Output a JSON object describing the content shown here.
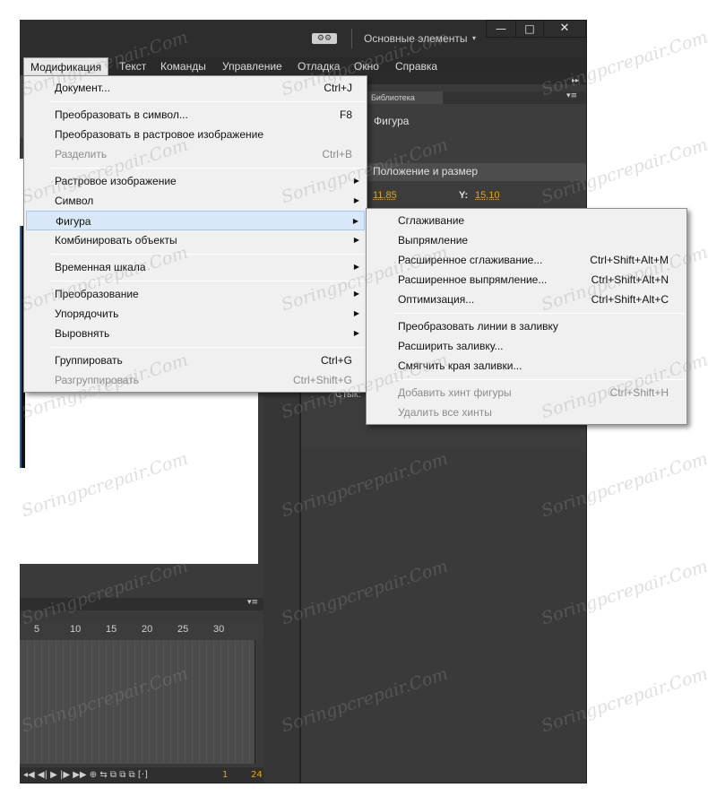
{
  "titlebar": {
    "workspace_label": "Основные элементы",
    "workspace_arrow": "▾",
    "workspace_icon": "⚙⚙",
    "minimize": "—",
    "maximize": "□",
    "close": "✕"
  },
  "menubar": {
    "items": [
      "Модификация",
      "Текст",
      "Команды",
      "Управление",
      "Отладка",
      "Окно",
      "Справка"
    ]
  },
  "panels": {
    "library_tab": "Библиотека",
    "shape_type": "Фигура",
    "position_header": "Положение и размер",
    "x_value": "11,85",
    "y_label": "Y:",
    "y_value": "15,10",
    "stroke_label": "Стык:",
    "expand_icon": "▸▸",
    "panel_menu_icon": "▾≡"
  },
  "timeline": {
    "ticks": [
      "5",
      "10",
      "15",
      "20",
      "25",
      "30"
    ],
    "frame": "1",
    "fps": "24",
    "controls": "◂◀ ◀| ▶ |▶ ▶▶  ⊕ ⇆  ⧉ ⧉ ⧉ [·]"
  },
  "main_menu": {
    "items": [
      {
        "label": "Документ...",
        "shortcut": "Ctrl+J"
      },
      {
        "label": "Преобразовать в символ...",
        "shortcut": "F8"
      },
      {
        "label": "Преобразовать в растровое изображение",
        "shortcut": ""
      },
      {
        "label": "Разделить",
        "shortcut": "Ctrl+B"
      },
      {
        "label": "Растровое изображение",
        "shortcut": ""
      },
      {
        "label": "Символ",
        "shortcut": ""
      },
      {
        "label": "Фигура",
        "shortcut": ""
      },
      {
        "label": "Комбинировать объекты",
        "shortcut": ""
      },
      {
        "label": "Временная шкала",
        "shortcut": ""
      },
      {
        "label": "Преобразование",
        "shortcut": ""
      },
      {
        "label": "Упорядочить",
        "shortcut": ""
      },
      {
        "label": "Выровнять",
        "shortcut": ""
      },
      {
        "label": "Группировать",
        "shortcut": "Ctrl+G"
      },
      {
        "label": "Разгруппировать",
        "shortcut": "Ctrl+Shift+G"
      }
    ],
    "arrow": "▶"
  },
  "sub_menu": {
    "items": [
      {
        "label": "Сглаживание",
        "shortcut": ""
      },
      {
        "label": "Выпрямление",
        "shortcut": ""
      },
      {
        "label": "Расширенное сглаживание...",
        "shortcut": "Ctrl+Shift+Alt+M"
      },
      {
        "label": "Расширенное выпрямление...",
        "shortcut": "Ctrl+Shift+Alt+N"
      },
      {
        "label": "Оптимизация...",
        "shortcut": "Ctrl+Shift+Alt+C"
      },
      {
        "label": "Преобразовать линии в заливку",
        "shortcut": ""
      },
      {
        "label": "Расширить заливку...",
        "shortcut": ""
      },
      {
        "label": "Смягчить края заливки...",
        "shortcut": ""
      },
      {
        "label": "Добавить хинт фигуры",
        "shortcut": "Ctrl+Shift+H"
      },
      {
        "label": "Удалить все хинты",
        "shortcut": ""
      }
    ]
  },
  "watermark": "Soringpcrepair.Com"
}
